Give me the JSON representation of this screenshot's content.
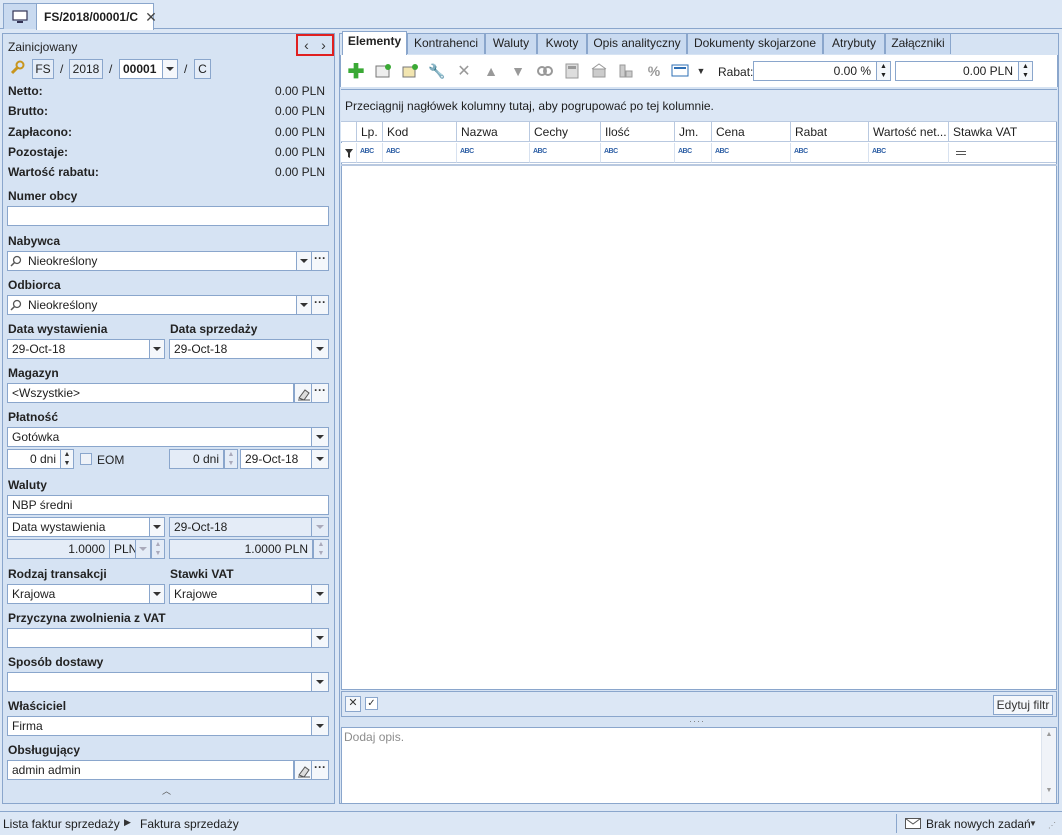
{
  "window": {
    "doc_tab": "FS/2018/00001/C",
    "close_glyph": "✕"
  },
  "header": {
    "status": "Zainicjowany",
    "prefix": "FS",
    "year": "2018",
    "number": "00001",
    "suffix": "C",
    "sep": "/"
  },
  "totals": [
    {
      "label": "Netto:",
      "value": "0.00 PLN"
    },
    {
      "label": "Brutto:",
      "value": "0.00 PLN"
    },
    {
      "label": "Zapłacono:",
      "value": "0.00 PLN"
    },
    {
      "label": "Pozostaje:",
      "value": "0.00 PLN"
    },
    {
      "label": "Wartość rabatu:",
      "value": "0.00 PLN"
    }
  ],
  "form": {
    "numer_obcy_label": "Numer obcy",
    "numer_obcy_value": "",
    "nabywca_label": "Nabywca",
    "nabywca_value": "Nieokreślony",
    "odbiorca_label": "Odbiorca",
    "odbiorca_value": "Nieokreślony",
    "data_wyst_label": "Data wystawienia",
    "data_wyst_value": "29-Oct-18",
    "data_sprz_label": "Data sprzedaży",
    "data_sprz_value": "29-Oct-18",
    "magazyn_label": "Magazyn",
    "magazyn_value": "<Wszystkie>",
    "platnosc_label": "Płatność",
    "platnosc_value": "Gotówka",
    "dni_value": "0 dni",
    "eom_label": "EOM",
    "dni2_value": "0 dni",
    "termin_value": "29-Oct-18",
    "waluty_label": "Waluty",
    "kurs_value": "NBP średni",
    "kurs_data_type": "Data wystawienia",
    "kurs_data_value": "29-Oct-18",
    "rate1": "1.0000",
    "currency": "PLN",
    "rate2": "1.0000 PLN",
    "rodzaj_label": "Rodzaj transakcji",
    "rodzaj_value": "Krajowa",
    "stawki_label": "Stawki VAT",
    "stawki_value": "Krajowe",
    "przyczyna_label": "Przyczyna zwolnienia z VAT",
    "przyczyna_value": "",
    "sposob_label": "Sposób dostawy",
    "sposob_value": "",
    "wlasciciel_label": "Właściciel",
    "wlasciciel_value": "Firma",
    "obslugujacy_label": "Obsługujący",
    "obslugujacy_value": "admin admin",
    "ellipsis": "···"
  },
  "tabs": [
    "Elementy",
    "Kontrahenci",
    "Waluty",
    "Kwoty",
    "Opis analityczny",
    "Dokumenty skojarzone",
    "Atrybuty",
    "Załączniki"
  ],
  "toolbar": {
    "rabat_label": "Rabat:",
    "rabat_pct": "0.00 %",
    "rabat_amount": "0.00 PLN"
  },
  "grid": {
    "group_hint": "Przeciągnij nagłówek kolumny tutaj, aby pogrupować po tej kolumnie.",
    "columns": [
      "Lp.",
      "Kod",
      "Nazwa",
      "Cechy",
      "Ilość",
      "Jm.",
      "Cena",
      "Rabat",
      "Wartość net...",
      "Stawka VAT"
    ],
    "abc": "ABC",
    "edit_filter": "Edytuj filtr"
  },
  "description_placeholder": "Dodaj opis.",
  "statusbar": {
    "crumb1": "Lista faktur sprzedaży",
    "crumb2": "Faktura sprzedaży",
    "tasks": "Brak nowych zadań"
  },
  "colors": {
    "accent_border": "#8aa6cc",
    "panel_bg": "#d6e3f3",
    "highlight_red": "#e02020",
    "add_green": "#3aa935"
  }
}
